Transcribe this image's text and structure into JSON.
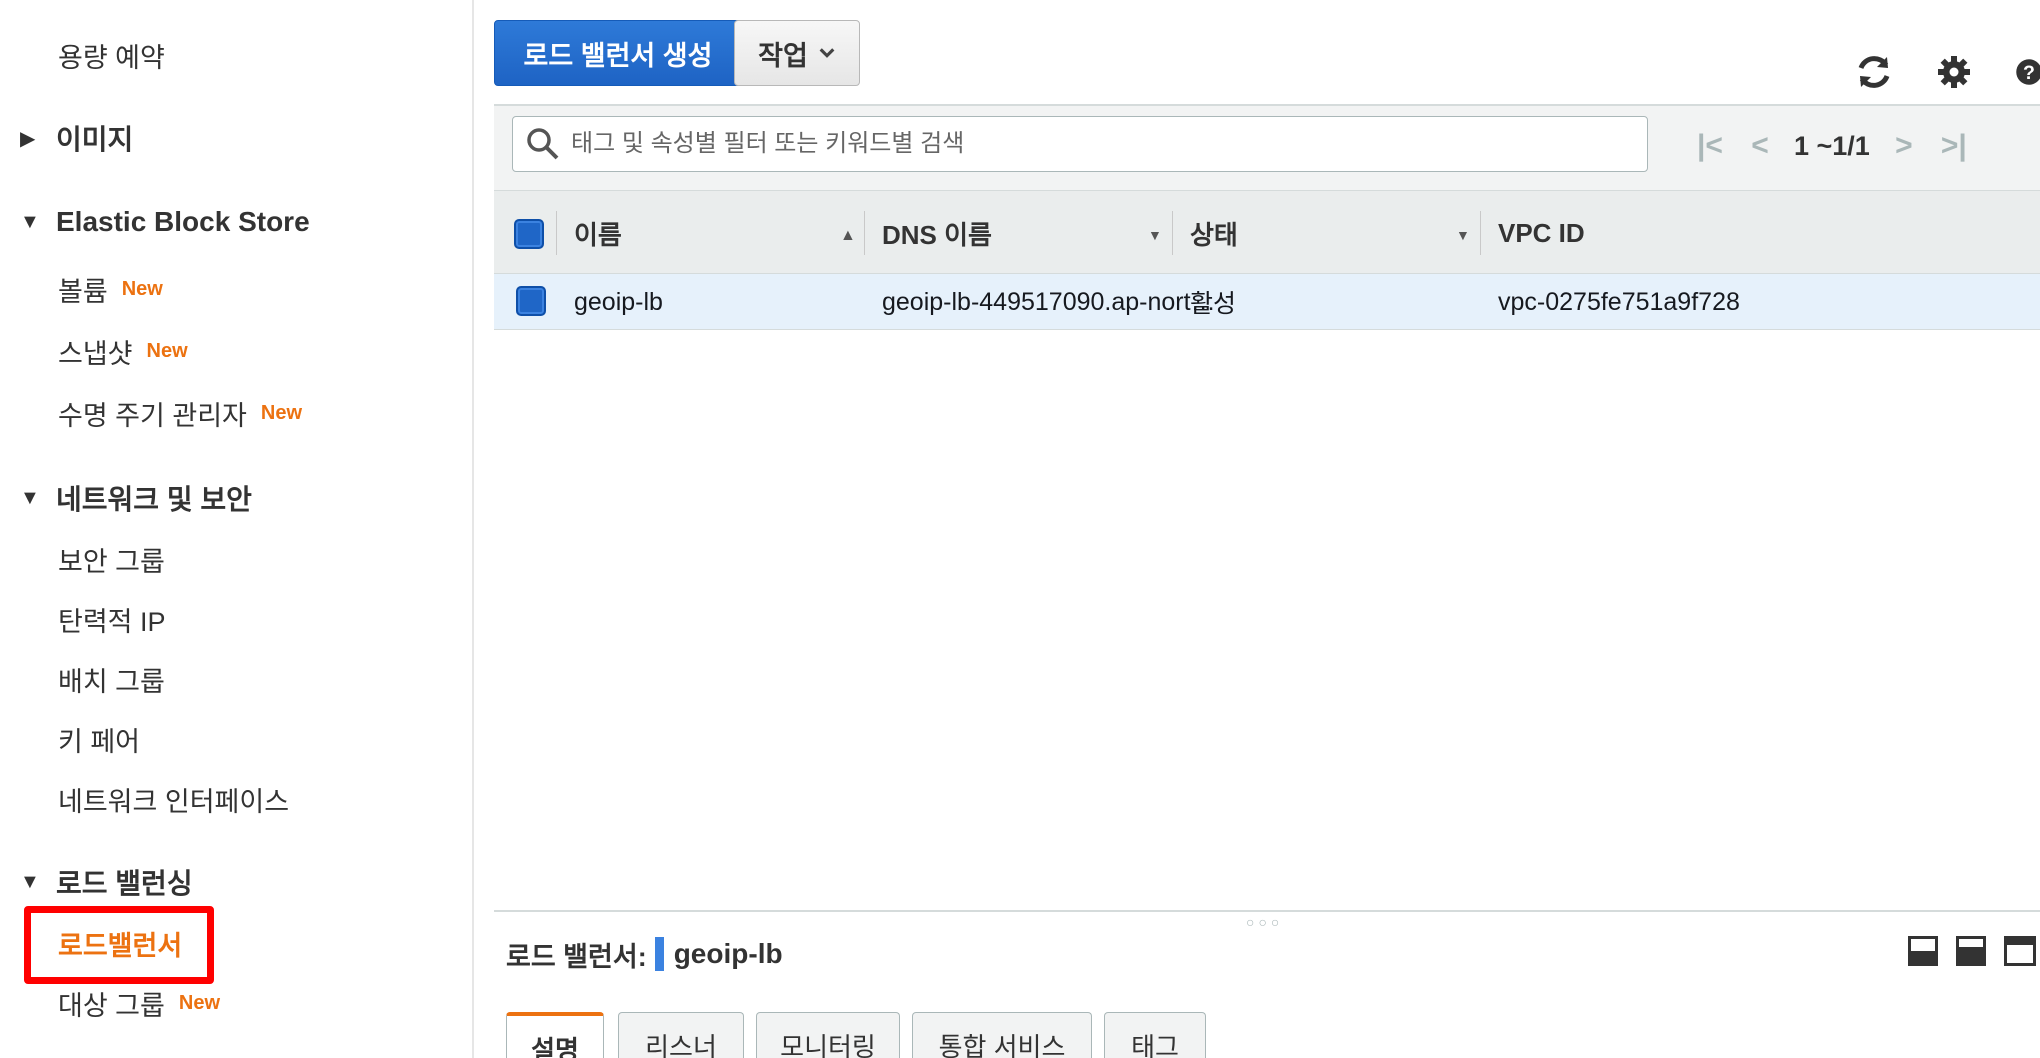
{
  "sidebar": {
    "top_item": "용량 예약",
    "sections": [
      {
        "label": "이미지",
        "expanded": false
      },
      {
        "label": "Elastic Block Store",
        "expanded": true
      },
      {
        "label": "네트워크 및 보안",
        "expanded": true
      },
      {
        "label": "로드 밸런싱",
        "expanded": true
      }
    ],
    "ebs_items": [
      {
        "label": "볼륨",
        "badge": "New"
      },
      {
        "label": "스냅샷",
        "badge": "New"
      },
      {
        "label": "수명 주기 관리자",
        "badge": "New"
      }
    ],
    "network_items": [
      "보안 그룹",
      "탄력적 IP",
      "배치 그룹",
      "키 페어",
      "네트워크 인터페이스"
    ],
    "lb_items": [
      {
        "label": "로드밸런서",
        "active": true
      },
      {
        "label": "대상 그룹",
        "badge": "New"
      }
    ]
  },
  "toolbar": {
    "create_label": "로드 밸런서 생성",
    "actions_label": "작업",
    "icons": [
      "refresh-icon",
      "gear-icon",
      "help-icon"
    ]
  },
  "filter": {
    "placeholder": "태그 및 속성별 필터 또는 키워드별 검색",
    "pagination": "1 ~1/1"
  },
  "table": {
    "columns": [
      "이름",
      "DNS 이름",
      "상태",
      "VPC ID"
    ],
    "rows": [
      {
        "name": "geoip-lb",
        "dns": "geoip-lb-449517090.ap-nort…",
        "state": "활성",
        "vpc": "vpc-0275fe751a9f728"
      }
    ]
  },
  "detail": {
    "label": "로드 밸런서:",
    "value": "geoip-lb",
    "tabs": [
      "설명",
      "리스너",
      "모니터링",
      "통합 서비스",
      "태그"
    ],
    "active_tab": "설명"
  },
  "colors": {
    "primary": "#1e63c4",
    "accent_orange": "#ec7211",
    "highlight_red": "#ff0000",
    "row_selected": "#e6f1fb"
  }
}
